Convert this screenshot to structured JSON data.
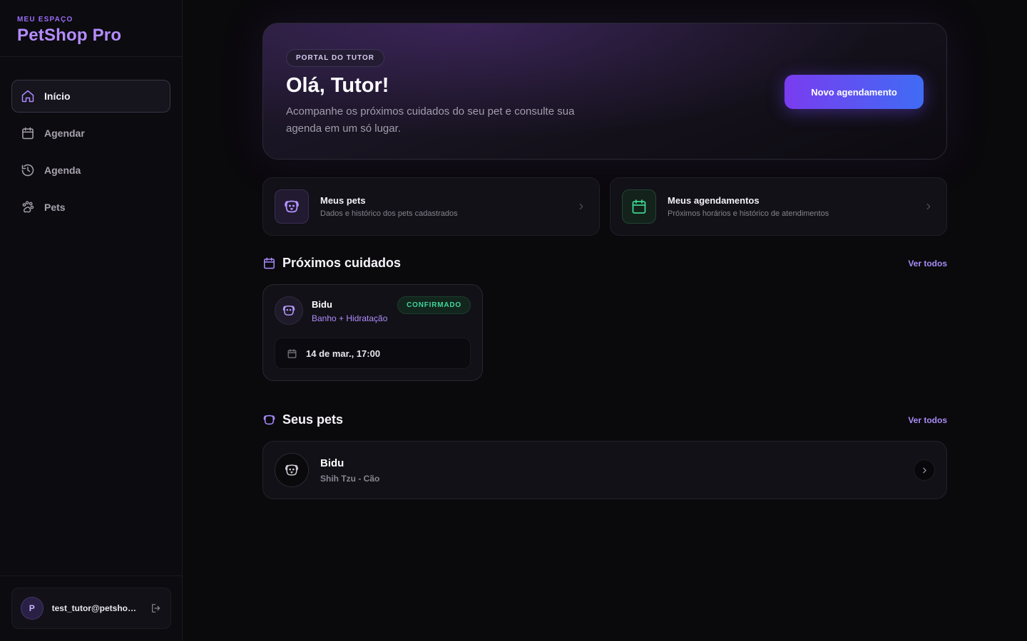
{
  "sidebar": {
    "kicker": "MEU ESPAÇO",
    "title": "PetShop Pro",
    "items": [
      {
        "label": "Início",
        "icon": "home-icon",
        "active": true
      },
      {
        "label": "Agendar",
        "icon": "calendar-icon"
      },
      {
        "label": "Agenda",
        "icon": "history-icon"
      },
      {
        "label": "Pets",
        "icon": "paw-icon"
      }
    ],
    "user": {
      "initial": "P",
      "email": "test_tutor@petshop..."
    }
  },
  "hero": {
    "badge": "PORTAL DO TUTOR",
    "title": "Olá, Tutor!",
    "subtitle": "Acompanhe os próximos cuidados do seu pet e consulte sua agenda em um só lugar.",
    "button": "Novo agendamento"
  },
  "quick": [
    {
      "title": "Meus pets",
      "desc": "Dados e histórico dos pets cadastrados"
    },
    {
      "title": "Meus agendamentos",
      "desc": "Próximos horários e histórico de atendimentos"
    }
  ],
  "upcoming": {
    "title": "Próximos cuidados",
    "see_all": "Ver todos",
    "card": {
      "pet": "Bidu",
      "service": "Banho + Hidratação",
      "status": "CONFIRMADO",
      "date": "14 de mar., 17:00"
    }
  },
  "pets": {
    "title": "Seus pets",
    "see_all": "Ver todos",
    "items": [
      {
        "name": "Bidu",
        "breed": "Shih Tzu - Cão"
      }
    ]
  },
  "colors": {
    "accent": "#9b6cf6",
    "success": "#43d49a",
    "background": "#0a090c"
  }
}
